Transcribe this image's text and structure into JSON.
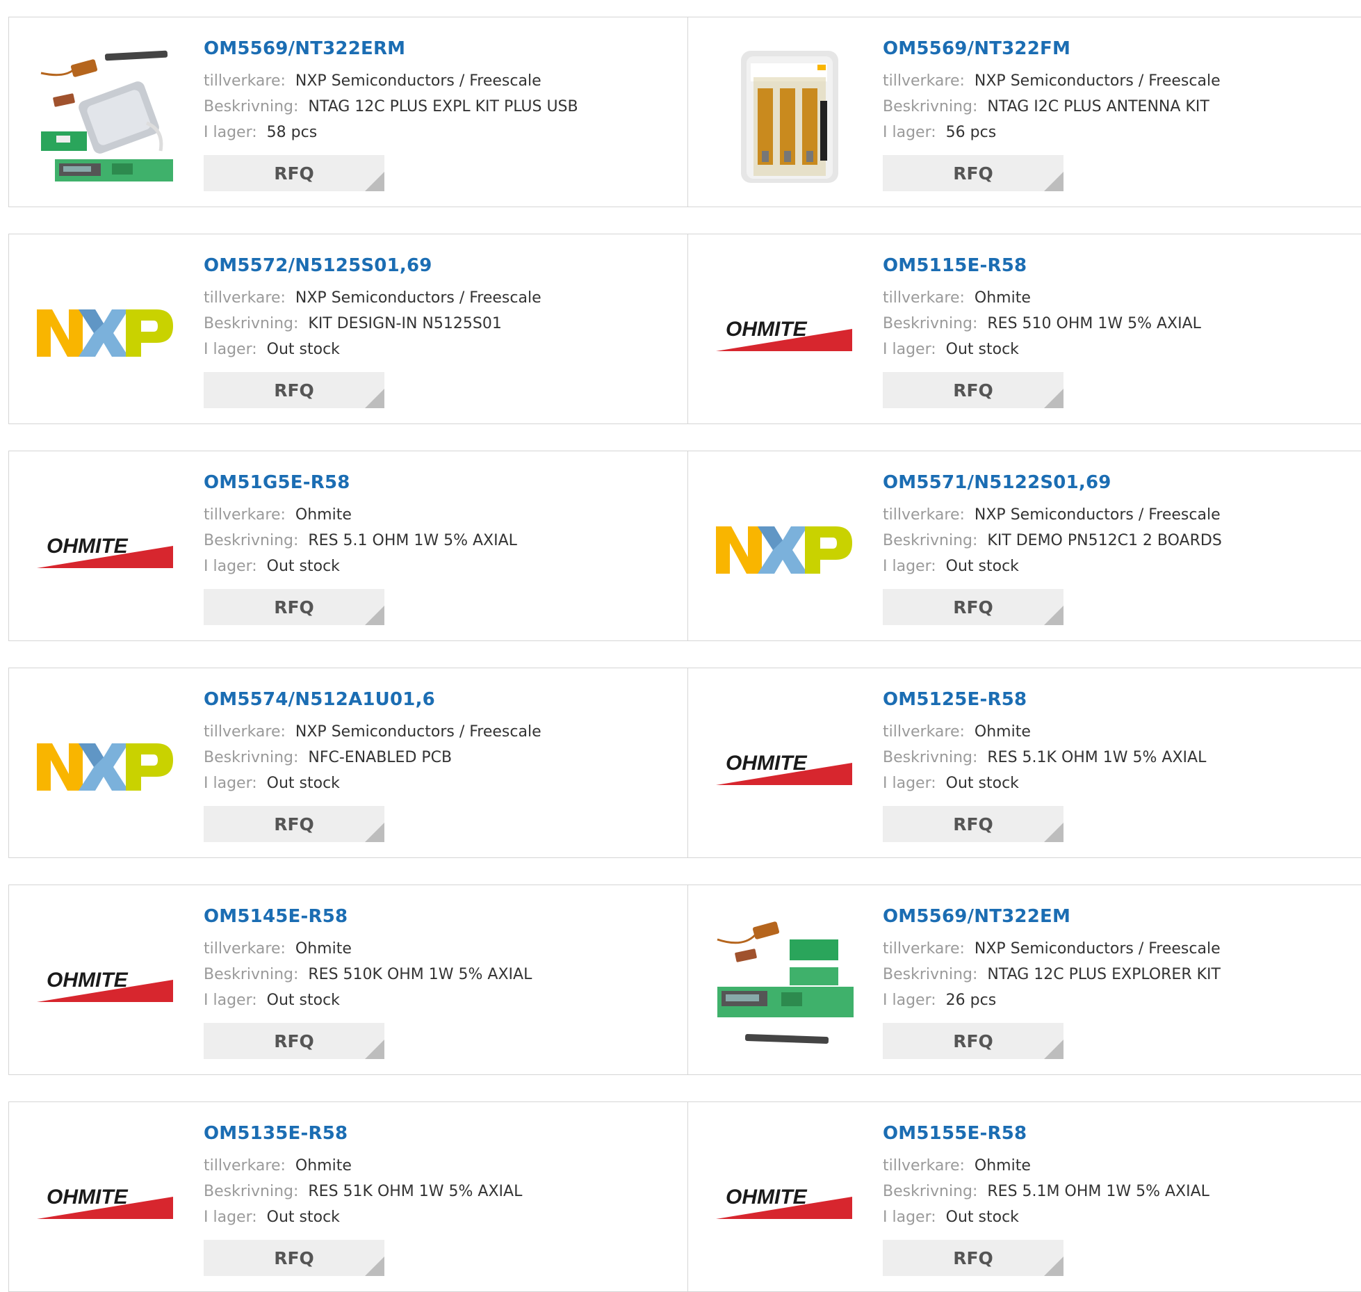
{
  "labels": {
    "manufacturer": "tillverkare:",
    "description": "Beskrivning:",
    "stock": "I lager:",
    "rfq": "RFQ"
  },
  "products": [
    {
      "part": "OM5569/NT322ERM",
      "manufacturer": "NXP Semiconductors / Freescale",
      "description": "NTAG 12C PLUS EXPL KIT PLUS USB",
      "stock": "58 pcs",
      "image": "kit-usb-reader-photo"
    },
    {
      "part": "OM5569/NT322FM",
      "manufacturer": "NXP Semiconductors / Freescale",
      "description": "NTAG I2C PLUS ANTENNA KIT",
      "stock": "56 pcs",
      "image": "antenna-kit-package-photo"
    },
    {
      "part": "OM5572/N5125S01,69",
      "manufacturer": "NXP Semiconductors / Freescale",
      "description": "KIT DESIGN-IN N5125S01",
      "stock": "Out stock",
      "image": "nxp-logo"
    },
    {
      "part": "OM5115E-R58",
      "manufacturer": "Ohmite",
      "description": "RES 510 OHM 1W 5% AXIAL",
      "stock": "Out stock",
      "image": "ohmite-logo"
    },
    {
      "part": "OM51G5E-R58",
      "manufacturer": "Ohmite",
      "description": "RES 5.1 OHM 1W 5% AXIAL",
      "stock": "Out stock",
      "image": "ohmite-logo"
    },
    {
      "part": "OM5571/N5122S01,69",
      "manufacturer": "NXP Semiconductors / Freescale",
      "description": "KIT DEMO PN512C1 2 BOARDS",
      "stock": "Out stock",
      "image": "nxp-logo"
    },
    {
      "part": "OM5574/N512A1U01,6",
      "manufacturer": "NXP Semiconductors / Freescale",
      "description": "NFC-ENABLED PCB",
      "stock": "Out stock",
      "image": "nxp-logo"
    },
    {
      "part": "OM5125E-R58",
      "manufacturer": "Ohmite",
      "description": "RES 5.1K OHM 1W 5% AXIAL",
      "stock": "Out stock",
      "image": "ohmite-logo"
    },
    {
      "part": "OM5145E-R58",
      "manufacturer": "Ohmite",
      "description": "RES 510K OHM 1W 5% AXIAL",
      "stock": "Out stock",
      "image": "ohmite-logo"
    },
    {
      "part": "OM5569/NT322EM",
      "manufacturer": "NXP Semiconductors / Freescale",
      "description": "NTAG 12C PLUS EXPLORER KIT",
      "stock": "26 pcs",
      "image": "explorer-kit-photo"
    },
    {
      "part": "OM5135E-R58",
      "manufacturer": "Ohmite",
      "description": "RES 51K OHM 1W 5% AXIAL",
      "stock": "Out stock",
      "image": "ohmite-logo"
    },
    {
      "part": "OM5155E-R58",
      "manufacturer": "Ohmite",
      "description": "RES 5.1M OHM 1W 5% AXIAL",
      "stock": "Out stock",
      "image": "ohmite-logo"
    }
  ],
  "logo_text": {
    "nxp": "NXP",
    "ohmite": "OHMITE"
  },
  "colors": {
    "link": "#1b6db3",
    "label": "#9a9a9a",
    "value": "#333333",
    "button_bg": "#eeeeee",
    "nxp_yellow": "#f9b500",
    "nxp_blue": "#7bb1db",
    "nxp_green": "#c9d200",
    "ohmite_red": "#d7262e"
  }
}
